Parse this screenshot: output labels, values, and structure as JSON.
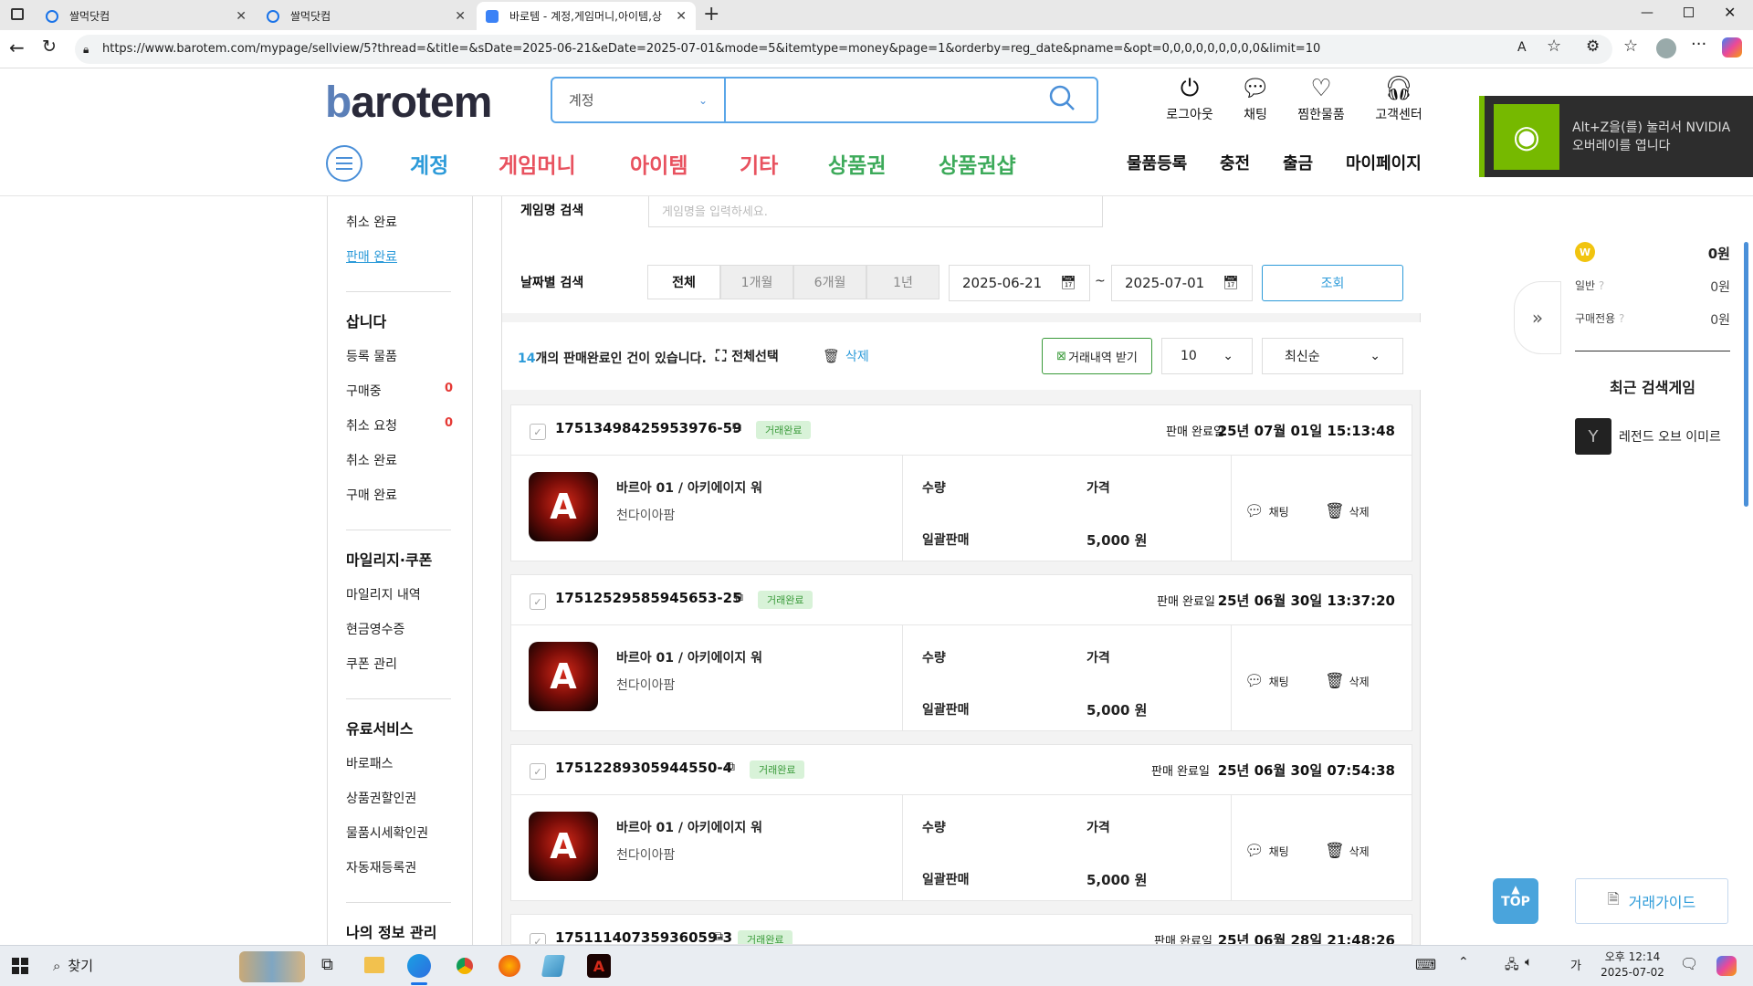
{
  "browser": {
    "tabs": [
      {
        "title": "쌀먹닷컴"
      },
      {
        "title": "쌀먹닷컴"
      },
      {
        "title": "바로템 - 계정,게임머니,아이템,상"
      }
    ],
    "url": "https://www.barotem.com/mypage/sellview/5?thread=&title=&sDate=2025-06-21&eDate=2025-07-01&mode=5&itemtype=money&page=1&orderby=reg_date&pname=&opt=0,0,0,0,0,0,0,0,0&limit=10"
  },
  "header": {
    "logo": "barotem",
    "search_category": "계정",
    "icons": {
      "logout": "로그아웃",
      "chat": "채팅",
      "wishlist": "찜한물품",
      "support": "고객센터"
    },
    "categories": [
      {
        "label": "계정",
        "color": "#2d9bd9"
      },
      {
        "label": "게임머니",
        "color": "#e8525f"
      },
      {
        "label": "아이템",
        "color": "#e8525f"
      },
      {
        "label": "기타",
        "color": "#e8525f"
      },
      {
        "label": "상품권",
        "color": "#3daa5a"
      },
      {
        "label": "상품권샵",
        "color": "#3daa5a"
      }
    ],
    "right_nav": [
      "물품등록",
      "충전",
      "출금",
      "마이페이지"
    ]
  },
  "nvidia": {
    "text": "Alt+Z을(를) 눌러서 NVIDIA 오버레이를 엽니다"
  },
  "sidebar": {
    "sell_items": [
      "취소 완료",
      "판매 완료"
    ],
    "buy_head": "삽니다",
    "buy_items": [
      "등록 물품",
      "구매중",
      "취소 요청",
      "취소 완료",
      "구매 완료"
    ],
    "buying_count": "0",
    "cancel_req_count": "0",
    "mileage_head": "마일리지·쿠폰",
    "mileage_items": [
      "마일리지 내역",
      "현금영수증",
      "쿠폰 관리"
    ],
    "paid_head": "유료서비스",
    "paid_items": [
      "바로패스",
      "상품권할인권",
      "물품시세확인권",
      "자동재등록권"
    ],
    "info_head": "나의 정보 관리"
  },
  "filters": {
    "game_label": "게임명 검색",
    "game_placeholder": "게임명을 입력하세요.",
    "date_label": "날짜별 검색",
    "periods": [
      "전체",
      "1개월",
      "6개월",
      "1년"
    ],
    "start_date": "2025-06-21",
    "tilde": "~",
    "end_date": "2025-07-01",
    "search_button": "조회"
  },
  "toolbar": {
    "count": "14",
    "count_suffix": "개의 판매완료인 건이 있습니다.",
    "select_all": "전체선택",
    "delete": "삭제",
    "export": "거래내역 받기",
    "limit": "10",
    "sort": "최신순"
  },
  "orders": [
    {
      "id": "17513498425953976-59",
      "status": "거래완료",
      "date_label": "판매 완료일",
      "date": "25년 07월 01일 15:13:48",
      "game": "바르아 01 / 아키에이지 워",
      "server": "천다이아팜",
      "qty_label": "수량",
      "price_label": "가격",
      "qty": "일괄판매",
      "price": "5,000 원",
      "chat": "채팅",
      "del": "삭제"
    },
    {
      "id": "17512529585945653-25",
      "status": "거래완료",
      "date_label": "판매 완료일",
      "date": "25년 06월 30일 13:37:20",
      "game": "바르아 01 / 아키에이지 워",
      "server": "천다이아팜",
      "qty_label": "수량",
      "price_label": "가격",
      "qty": "일괄판매",
      "price": "5,000 원",
      "chat": "채팅",
      "del": "삭제"
    },
    {
      "id": "17512289305944550-4",
      "status": "거래완료",
      "date_label": "판매 완료일",
      "date": "25년 06월 30일 07:54:38",
      "game": "바르아 01 / 아키에이지 워",
      "server": "천다이아팜",
      "qty_label": "수량",
      "price_label": "가격",
      "qty": "일괄판매",
      "price": "5,000 원",
      "chat": "채팅",
      "del": "삭제"
    },
    {
      "id": "17511140735936059-3",
      "status": "거래완료",
      "date_label": "판매 완료일",
      "date": "25년 06월 28일 21:48:26"
    }
  ],
  "right_panel": {
    "balance": "0원",
    "general_label": "일반",
    "general_value": "0원",
    "purchase_label": "구매전용",
    "purchase_value": "0원",
    "recent_title": "최근 검색게임",
    "recent_game": "레전드 오브 이미르",
    "guide": "거래가이드",
    "top_button": "TOP"
  },
  "taskbar": {
    "search": "찾기",
    "time": "오후 12:14",
    "date": "2025-07-02"
  }
}
